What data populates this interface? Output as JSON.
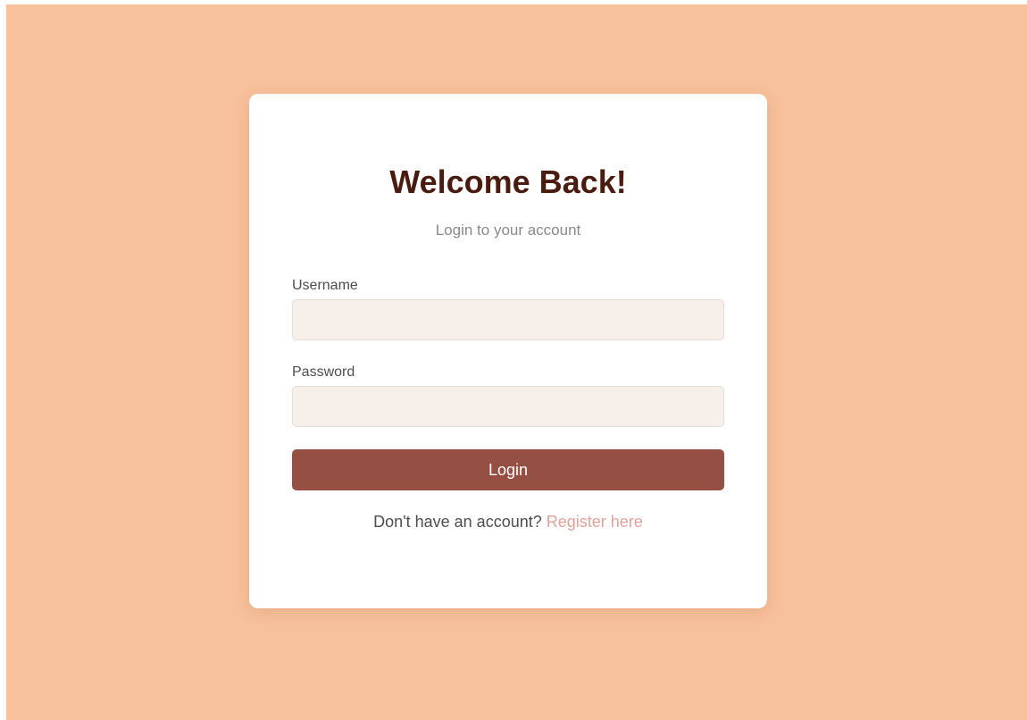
{
  "login": {
    "title": "Welcome Back!",
    "subtitle": "Login to your account",
    "username_label": "Username",
    "username_value": "",
    "password_label": "Password",
    "password_value": "",
    "button_label": "Login",
    "footer_prompt": "Don't have an account?",
    "register_link": "Register here"
  },
  "colors": {
    "background": "#f7c19b",
    "title": "#4a1c10",
    "button": "#955043",
    "input_background": "#f6efea",
    "link": "#e0a39b"
  }
}
